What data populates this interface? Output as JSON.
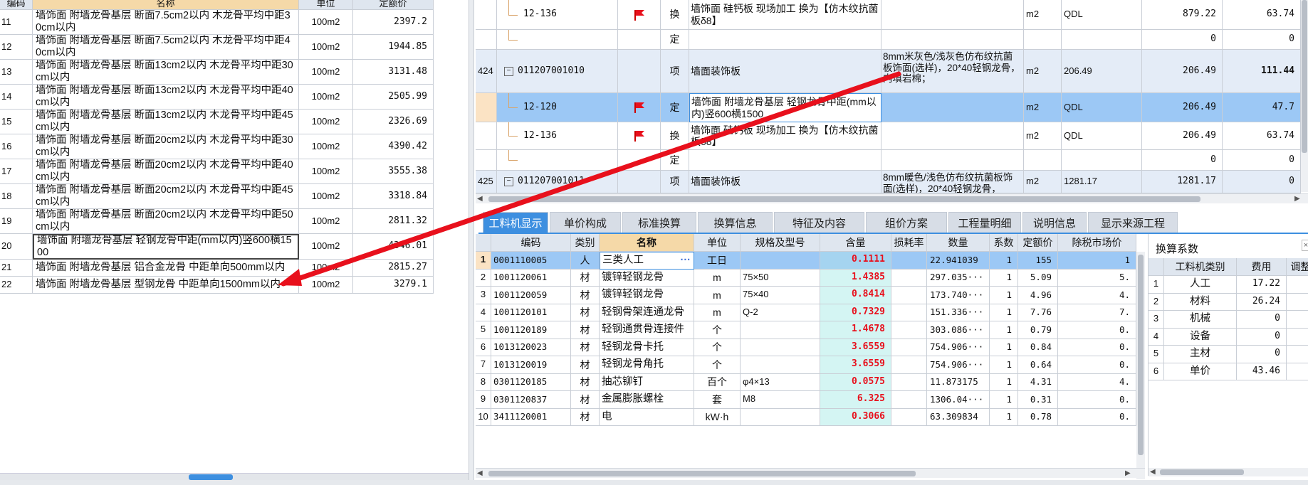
{
  "left_table": {
    "headers": [
      "编码",
      "名称",
      "单位",
      "定额价"
    ],
    "rows": [
      {
        "no": "11",
        "name": "墙饰面 附墙龙骨基层 断面7.5cm2以内 木龙骨平均中距30cm以内",
        "unit": "100m2",
        "price": "2397.2"
      },
      {
        "no": "12",
        "name": "墙饰面 附墙龙骨基层 断面7.5cm2以内 木龙骨平均中距40cm以内",
        "unit": "100m2",
        "price": "1944.85"
      },
      {
        "no": "13",
        "name": "墙饰面 附墙龙骨基层 断面13cm2以内 木龙骨平均中距30cm以内",
        "unit": "100m2",
        "price": "3131.48"
      },
      {
        "no": "14",
        "name": "墙饰面 附墙龙骨基层 断面13cm2以内 木龙骨平均中距40cm以内",
        "unit": "100m2",
        "price": "2505.99"
      },
      {
        "no": "15",
        "name": "墙饰面 附墙龙骨基层 断面13cm2以内 木龙骨平均中距45cm以内",
        "unit": "100m2",
        "price": "2326.69"
      },
      {
        "no": "16",
        "name": "墙饰面 附墙龙骨基层 断面20cm2以内 木龙骨平均中距30cm以内",
        "unit": "100m2",
        "price": "4390.42"
      },
      {
        "no": "17",
        "name": "墙饰面 附墙龙骨基层 断面20cm2以内 木龙骨平均中距40cm以内",
        "unit": "100m2",
        "price": "3555.38"
      },
      {
        "no": "18",
        "name": "墙饰面 附墙龙骨基层 断面20cm2以内 木龙骨平均中距45cm以内",
        "unit": "100m2",
        "price": "3318.84"
      },
      {
        "no": "19",
        "name": "墙饰面 附墙龙骨基层 断面20cm2以内 木龙骨平均中距50cm以内",
        "unit": "100m2",
        "price": "2811.32"
      },
      {
        "no": "20",
        "name": "墙饰面 附墙龙骨基层 轻钢龙骨中距(mm以内)竖600横1500",
        "unit": "100m2",
        "price": "4346.01"
      },
      {
        "no": "21",
        "name": "墙饰面 附墙龙骨基层 铝合金龙骨 中距单向500mm以内",
        "unit": "100m2",
        "price": "2815.27"
      },
      {
        "no": "22",
        "name": "墙饰面 附墙龙骨基层 型钢龙骨 中距单向1500mm以内",
        "unit": "100m2",
        "price": "3279.1"
      }
    ]
  },
  "top_table": {
    "rows": [
      {
        "seq": "",
        "code": "12-136",
        "flag": true,
        "type": "换",
        "name": "墙饰面 硅钙板 现场加工 换为【仿木纹抗菌板δ8】",
        "feature": "",
        "unit": "m2",
        "qty_expr": "QDL",
        "qty": "879.22",
        "price": "63.74"
      },
      {
        "seq": "",
        "code": "",
        "flag": false,
        "type": "定",
        "name": "",
        "feature": "",
        "unit": "",
        "qty_expr": "",
        "qty": "0",
        "price": "0"
      },
      {
        "seq": "424",
        "code": "011207001010",
        "flag": false,
        "type": "项",
        "name": "墙面装饰板",
        "feature": "8mm米灰色/浅灰色仿布纹抗菌板饰面(选样)，20*40轻钢龙骨，内填岩棉；",
        "unit": "m2",
        "qty_expr": "206.49",
        "qty": "206.49",
        "price": "111.44"
      },
      {
        "seq": "",
        "code": "12-120",
        "flag": true,
        "type": "定",
        "name": "墙饰面 附墙龙骨基层 轻钢龙骨中距(mm以内)竖600横1500",
        "feature": "",
        "unit": "m2",
        "qty_expr": "QDL",
        "qty": "206.49",
        "price": "47.7"
      },
      {
        "seq": "",
        "code": "12-136",
        "flag": true,
        "type": "换",
        "name": "墙饰面 硅钙板 现场加工 换为【仿木纹抗菌板δ8】",
        "feature": "",
        "unit": "m2",
        "qty_expr": "QDL",
        "qty": "206.49",
        "price": "63.74"
      },
      {
        "seq": "",
        "code": "",
        "flag": false,
        "type": "定",
        "name": "",
        "feature": "",
        "unit": "",
        "qty_expr": "",
        "qty": "0",
        "price": "0"
      },
      {
        "seq": "425",
        "code": "011207001011",
        "flag": false,
        "type": "项",
        "name": "墙面装饰板",
        "feature": "8mm暖色/浅色仿布纹抗菌板饰面(选样)，20*40轻钢龙骨，",
        "unit": "m2",
        "qty_expr": "1281.17",
        "qty": "1281.17",
        "price": "0"
      }
    ]
  },
  "tabs": [
    "工料机显示",
    "单价构成",
    "标准换算",
    "换算信息",
    "特征及内容",
    "组价方案",
    "工程量明细",
    "说明信息",
    "显示来源工程"
  ],
  "resource_table": {
    "headers": [
      "编码",
      "类别",
      "名称",
      "单位",
      "规格及型号",
      "含量",
      "损耗率",
      "数量",
      "系数",
      "定额价",
      "除税市场价"
    ],
    "rows": [
      {
        "no": "1",
        "code": "0001110005",
        "cat": "人",
        "name": "三类人工",
        "unit": "工日",
        "spec": "",
        "content": "0.1111",
        "qty": "22.941039",
        "coef": "1",
        "price": "155",
        "mkt": "1"
      },
      {
        "no": "2",
        "code": "1001120061",
        "cat": "材",
        "name": "镀锌轻钢龙骨",
        "unit": "m",
        "spec": "75×50",
        "content": "1.4385",
        "qty": "297.035···",
        "coef": "1",
        "price": "5.09",
        "mkt": "5."
      },
      {
        "no": "3",
        "code": "1001120059",
        "cat": "材",
        "name": "镀锌轻钢龙骨",
        "unit": "m",
        "spec": "75×40",
        "content": "0.8414",
        "qty": "173.740···",
        "coef": "1",
        "price": "4.96",
        "mkt": "4."
      },
      {
        "no": "4",
        "code": "1001120101",
        "cat": "材",
        "name": "轻钢骨架连通龙骨",
        "unit": "m",
        "spec": "Q-2",
        "content": "0.7329",
        "qty": "151.336···",
        "coef": "1",
        "price": "7.76",
        "mkt": "7."
      },
      {
        "no": "5",
        "code": "1001120189",
        "cat": "材",
        "name": "轻钢通贯骨连接件",
        "unit": "个",
        "spec": "",
        "content": "1.4678",
        "qty": "303.086···",
        "coef": "1",
        "price": "0.79",
        "mkt": "0."
      },
      {
        "no": "6",
        "code": "1013120023",
        "cat": "材",
        "name": "轻钢龙骨卡托",
        "unit": "个",
        "spec": "",
        "content": "3.6559",
        "qty": "754.906···",
        "coef": "1",
        "price": "0.84",
        "mkt": "0."
      },
      {
        "no": "7",
        "code": "1013120019",
        "cat": "材",
        "name": "轻钢龙骨角托",
        "unit": "个",
        "spec": "",
        "content": "3.6559",
        "qty": "754.906···",
        "coef": "1",
        "price": "0.64",
        "mkt": "0."
      },
      {
        "no": "8",
        "code": "0301120185",
        "cat": "材",
        "name": "抽芯铆钉",
        "unit": "百个",
        "spec": "φ4×13",
        "content": "0.0575",
        "qty": "11.873175",
        "coef": "1",
        "price": "4.31",
        "mkt": "4."
      },
      {
        "no": "9",
        "code": "0301120837",
        "cat": "材",
        "name": "金属膨胀螺栓",
        "unit": "套",
        "spec": "M8",
        "content": "6.325",
        "qty": "1306.04···",
        "coef": "1",
        "price": "0.31",
        "mkt": "0."
      },
      {
        "no": "10",
        "code": "3411120001",
        "cat": "材",
        "name": "电",
        "unit": "kW·h",
        "spec": "",
        "content": "0.3066",
        "qty": "63.309834",
        "coef": "1",
        "price": "0.78",
        "mkt": "0."
      }
    ]
  },
  "coef_panel": {
    "title": "换算系数",
    "headers": [
      "工料机类别",
      "费用",
      "调整"
    ],
    "rows": [
      {
        "no": "1",
        "cat": "人工",
        "fee": "17.22"
      },
      {
        "no": "2",
        "cat": "材料",
        "fee": "26.24"
      },
      {
        "no": "3",
        "cat": "机械",
        "fee": "0"
      },
      {
        "no": "4",
        "cat": "设备",
        "fee": "0"
      },
      {
        "no": "5",
        "cat": "主材",
        "fee": "0"
      },
      {
        "no": "6",
        "cat": "单价",
        "fee": "43.46"
      }
    ]
  },
  "colors": {
    "selected": "#9cc8f5",
    "header": "#dfe6ef",
    "tab_active": "#3d8fe0",
    "content_bg": "#d4f5f3",
    "arrow": "#e8101c"
  }
}
